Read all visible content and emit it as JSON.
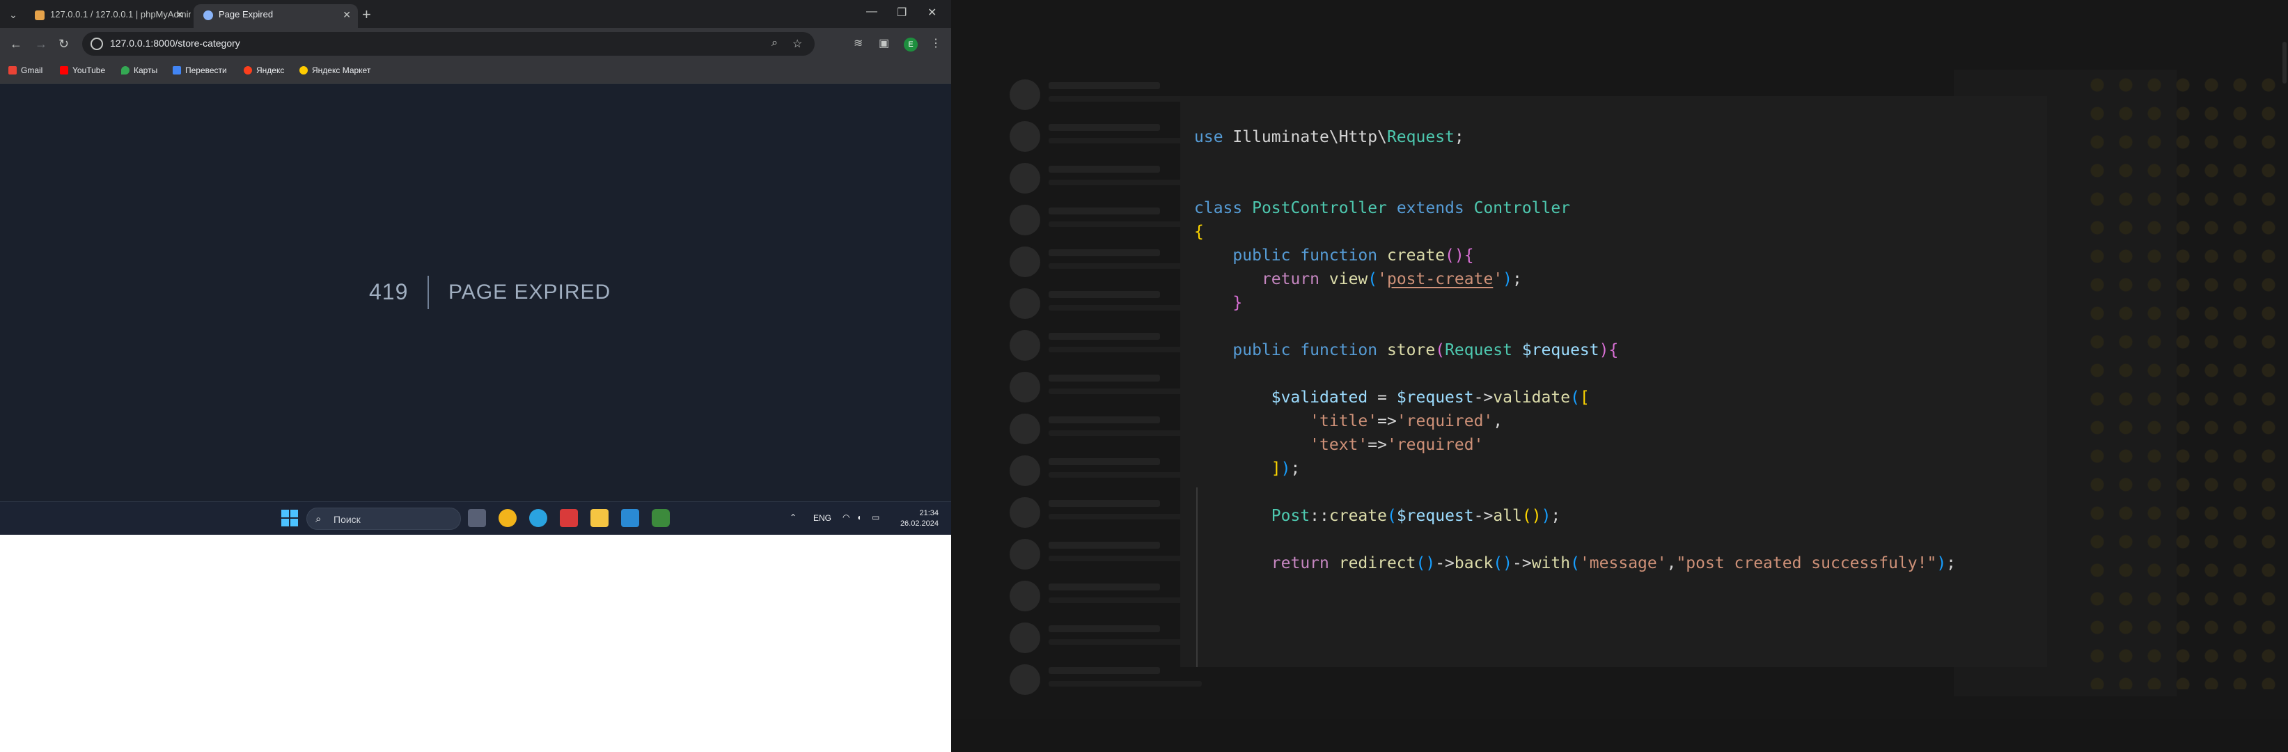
{
  "browser": {
    "tabs": [
      {
        "title": "127.0.0.1 / 127.0.0.1 | phpMyAdmin",
        "active": false
      },
      {
        "title": "Page Expired",
        "active": true
      }
    ],
    "url": "127.0.0.1:8000/store-category",
    "bookmarks": [
      {
        "label": "Gmail",
        "color": "#ea4335"
      },
      {
        "label": "YouTube",
        "color": "#ff0000"
      },
      {
        "label": "Карты",
        "color": "#34a853"
      },
      {
        "label": "Перевести",
        "color": "#4285f4"
      },
      {
        "label": "Яндекс",
        "color": "#fc3f1d"
      },
      {
        "label": "Яндекс Маркет",
        "color": "#ffcc00"
      }
    ],
    "avatar_letter": "Е"
  },
  "error": {
    "code": "419",
    "message": "Page Expired"
  },
  "taskbar": {
    "search_placeholder": "Поиск",
    "lang": "ENG",
    "time": "21:34",
    "date": "26.02.2024"
  },
  "code": {
    "lines": [
      [
        {
          "t": "use ",
          "c": "kw"
        },
        {
          "t": "Illuminate\\Http\\",
          "c": "plain"
        },
        {
          "t": "Request",
          "c": "cls"
        },
        {
          "t": ";",
          "c": "plain"
        }
      ],
      [],
      [],
      [
        {
          "t": "class ",
          "c": "kw"
        },
        {
          "t": "PostController ",
          "c": "cls"
        },
        {
          "t": "extends ",
          "c": "kw"
        },
        {
          "t": "Controller",
          "c": "cls"
        }
      ],
      [
        {
          "t": "{",
          "c": "br1"
        }
      ],
      [
        {
          "t": "    ",
          "c": "plain"
        },
        {
          "t": "public ",
          "c": "kw"
        },
        {
          "t": "function ",
          "c": "kw"
        },
        {
          "t": "create",
          "c": "fn"
        },
        {
          "t": "(){",
          "c": "br2"
        }
      ],
      [
        {
          "t": "       ",
          "c": "plain"
        },
        {
          "t": "return ",
          "c": "ctl"
        },
        {
          "t": "view",
          "c": "fn"
        },
        {
          "t": "(",
          "c": "br3"
        },
        {
          "t": "'",
          "c": "str"
        },
        {
          "t": "post-create",
          "c": "str-u"
        },
        {
          "t": "'",
          "c": "str"
        },
        {
          "t": ")",
          "c": "br3"
        },
        {
          "t": ";",
          "c": "plain"
        }
      ],
      [
        {
          "t": "    ",
          "c": "plain"
        },
        {
          "t": "}",
          "c": "br2"
        }
      ],
      [],
      [
        {
          "t": "    ",
          "c": "plain"
        },
        {
          "t": "public ",
          "c": "kw"
        },
        {
          "t": "function ",
          "c": "kw"
        },
        {
          "t": "store",
          "c": "fn"
        },
        {
          "t": "(",
          "c": "br2"
        },
        {
          "t": "Request ",
          "c": "cls"
        },
        {
          "t": "$request",
          "c": "var"
        },
        {
          "t": "){",
          "c": "br2"
        }
      ],
      [],
      [
        {
          "t": "        ",
          "c": "plain"
        },
        {
          "t": "$validated ",
          "c": "var"
        },
        {
          "t": "= ",
          "c": "plain"
        },
        {
          "t": "$request",
          "c": "var"
        },
        {
          "t": "->",
          "c": "plain"
        },
        {
          "t": "validate",
          "c": "fn"
        },
        {
          "t": "(",
          "c": "br3"
        },
        {
          "t": "[",
          "c": "br1"
        }
      ],
      [
        {
          "t": "            ",
          "c": "plain"
        },
        {
          "t": "'title'",
          "c": "str"
        },
        {
          "t": "=>",
          "c": "plain"
        },
        {
          "t": "'required'",
          "c": "str"
        },
        {
          "t": ",",
          "c": "plain"
        }
      ],
      [
        {
          "t": "            ",
          "c": "plain"
        },
        {
          "t": "'text'",
          "c": "str"
        },
        {
          "t": "=>",
          "c": "plain"
        },
        {
          "t": "'required'",
          "c": "str"
        }
      ],
      [
        {
          "t": "        ",
          "c": "plain"
        },
        {
          "t": "]",
          "c": "br1"
        },
        {
          "t": ")",
          "c": "br3"
        },
        {
          "t": ";",
          "c": "plain"
        }
      ],
      [],
      [
        {
          "t": "        ",
          "c": "plain"
        },
        {
          "t": "Post",
          "c": "cls"
        },
        {
          "t": "::",
          "c": "plain"
        },
        {
          "t": "create",
          "c": "fn"
        },
        {
          "t": "(",
          "c": "br3"
        },
        {
          "t": "$request",
          "c": "var"
        },
        {
          "t": "->",
          "c": "plain"
        },
        {
          "t": "all",
          "c": "fn"
        },
        {
          "t": "()",
          "c": "br1"
        },
        {
          "t": ")",
          "c": "br3"
        },
        {
          "t": ";",
          "c": "plain"
        }
      ],
      [],
      [
        {
          "t": "        ",
          "c": "plain"
        },
        {
          "t": "return ",
          "c": "ctl"
        },
        {
          "t": "redirect",
          "c": "fn"
        },
        {
          "t": "()",
          "c": "br3"
        },
        {
          "t": "->",
          "c": "plain"
        },
        {
          "t": "back",
          "c": "fn"
        },
        {
          "t": "()",
          "c": "br3"
        },
        {
          "t": "->",
          "c": "plain"
        },
        {
          "t": "with",
          "c": "fn"
        },
        {
          "t": "(",
          "c": "br3"
        },
        {
          "t": "'message'",
          "c": "str"
        },
        {
          "t": ",",
          "c": "plain"
        },
        {
          "t": "\"post created successfuly!\"",
          "c": "str"
        },
        {
          "t": ")",
          "c": "br3"
        },
        {
          "t": ";",
          "c": "plain"
        }
      ]
    ]
  },
  "colors": {
    "page_bg": "#1a202c",
    "error_text": "#a0aec0",
    "editor_bg": "#1e1e1e"
  }
}
